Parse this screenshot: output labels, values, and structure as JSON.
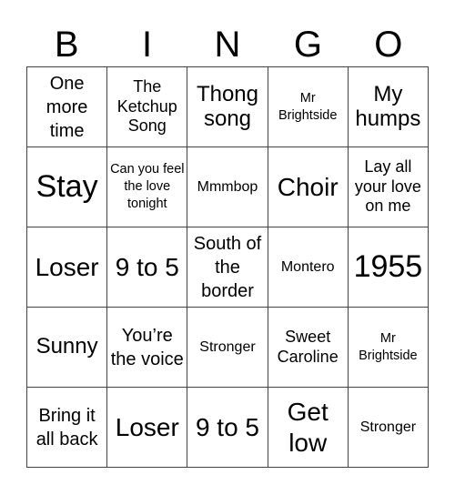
{
  "header": {
    "letters": [
      "B",
      "I",
      "N",
      "G",
      "O"
    ]
  },
  "cells": [
    [
      "One more time",
      "The Ketchup Song",
      "Thong song",
      "Mr Brightside",
      "My humps"
    ],
    [
      "Stay",
      "Can you feel the love tonight",
      "Mmmbop",
      "Choir",
      "Lay all your love on me"
    ],
    [
      "Loser",
      "9 to 5",
      "South of the border",
      "Montero",
      "1955"
    ],
    [
      "Sunny",
      "You’re the voice",
      "Stronger",
      "Sweet Caroline",
      "Mr Brightside"
    ],
    [
      "Bring it all back",
      "Loser",
      "9 to 5",
      "Get low",
      "Stronger"
    ]
  ]
}
